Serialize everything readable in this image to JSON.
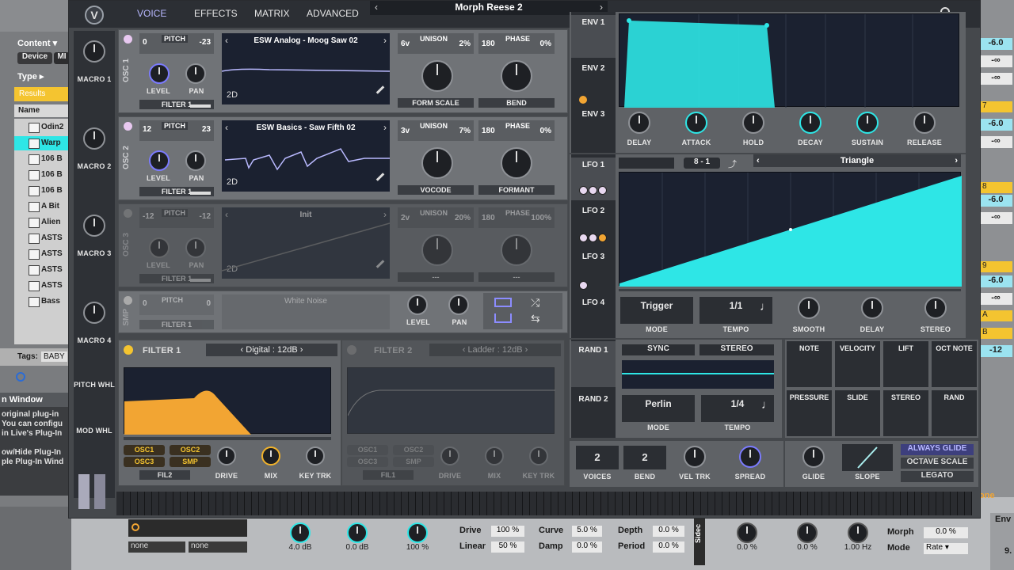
{
  "host": {
    "browser": {
      "content_label": "Content",
      "device_label": "Device",
      "mi_label": "MI",
      "type_label": "Type",
      "results_label": "Results",
      "name_header": "Name",
      "items": [
        "Odin2",
        "Warp",
        "106 B",
        "106 B",
        "106 B",
        "A Bit",
        "Alien",
        "ASTS",
        "ASTS",
        "ASTS",
        "ASTS",
        "Bass"
      ],
      "tags_label": "Tags:",
      "tags_value": "BABY",
      "info_title": "n Window",
      "info_lines": [
        "original plug-in",
        "You can configu",
        "in Live's Plug-In",
        "",
        "ow/Hide Plug-In",
        "ple Plug-In Wind"
      ]
    },
    "bottom": {
      "none_1": "none",
      "none_2": "none",
      "gain_1": "4.0 dB",
      "gain_2": "0.0 dB",
      "gain_3": "100 %",
      "drive_label": "Drive",
      "drive_value": "100 %",
      "linear_label": "Linear",
      "linear_value": "50 %",
      "curve_label": "Curve",
      "curve_value": "5.0 %",
      "damp_label": "Damp",
      "damp_value": "0.0 %",
      "depth_label": "Depth",
      "depth_value": "0.0 %",
      "period_label": "Period",
      "period_value": "0.0 %",
      "sidechain_label": "Sidec",
      "k1_value": "0.0 %",
      "k2_value": "0.0 %",
      "k3_value": "1.00 Hz",
      "morph_label": "Morph",
      "morph_value": "0.0 %",
      "mode_label": "Mode",
      "mode_value": "Rate",
      "env_label": "Env",
      "nine": "9."
    },
    "right_mixer": [
      "-6.0",
      "-∞",
      "-∞",
      "-6.0",
      "-∞",
      "-6.0",
      "-∞",
      "-6.0",
      "-∞",
      "-12"
    ],
    "right_yellow": [
      "7",
      "8",
      "9",
      "A",
      "B"
    ],
    "right_one": "one"
  },
  "plugin": {
    "tabs": [
      "VOICE",
      "EFFECTS",
      "MATRIX",
      "ADVANCED"
    ],
    "preset_name": "Morph Reese 2",
    "macros": [
      "MACRO 1",
      "MACRO 2",
      "MACRO 3",
      "MACRO 4"
    ],
    "pitch_whl": "PITCH WHL",
    "mod_whl": "MOD WHL",
    "osc": [
      {
        "side": "OSC 1",
        "pitch_l": "0",
        "pitch_r": "-23",
        "pitch_label": "PITCH",
        "level": "LEVEL",
        "pan": "PAN",
        "filter": "FILTER 1",
        "wave": "ESW Analog - Moog Saw 02",
        "mode": "2D",
        "unison_l": "6v",
        "unison_label": "UNISON",
        "unison_r": "2%",
        "phase_l": "180",
        "phase_label": "PHASE",
        "phase_r": "0%",
        "knob_a": "FORM SCALE",
        "knob_b": "BEND"
      },
      {
        "side": "OSC 2",
        "pitch_l": "12",
        "pitch_r": "23",
        "pitch_label": "PITCH",
        "level": "LEVEL",
        "pan": "PAN",
        "filter": "FILTER 1",
        "wave": "ESW Basics - Saw Fifth 02",
        "mode": "2D",
        "unison_l": "3v",
        "unison_label": "UNISON",
        "unison_r": "7%",
        "phase_l": "180",
        "phase_label": "PHASE",
        "phase_r": "0%",
        "knob_a": "VOCODE",
        "knob_b": "FORMANT"
      },
      {
        "side": "OSC 3",
        "pitch_l": "-12",
        "pitch_r": "-12",
        "pitch_label": "PITCH",
        "level": "LEVEL",
        "pan": "PAN",
        "filter": "FILTER 1",
        "wave": "Init",
        "mode": "2D",
        "unison_l": "2v",
        "unison_label": "UNISON",
        "unison_r": "20%",
        "phase_l": "180",
        "phase_label": "PHASE",
        "phase_r": "100%",
        "knob_a": "---",
        "knob_b": "---"
      }
    ],
    "smp": {
      "side": "SMP",
      "pitch_l": "0",
      "pitch_r": "0",
      "pitch_label": "PITCH",
      "filter": "FILTER 1",
      "sample": "White Noise",
      "level": "LEVEL",
      "pan": "PAN"
    },
    "filter1": {
      "title": "FILTER 1",
      "type": "Digital : 12dB",
      "osc1": "OSC1",
      "osc2": "OSC2",
      "osc3": "OSC3",
      "smp": "SMP",
      "fil": "FIL2",
      "drive": "DRIVE",
      "mix": "MIX",
      "keytrk": "KEY TRK"
    },
    "filter2": {
      "title": "FILTER 2",
      "type": "Ladder : 12dB",
      "osc1": "OSC1",
      "osc2": "OSC2",
      "osc3": "OSC3",
      "smp": "SMP",
      "fil": "FIL1",
      "drive": "DRIVE",
      "mix": "MIX",
      "keytrk": "KEY TRK"
    },
    "env": {
      "tabs": [
        "ENV 1",
        "ENV 2",
        "ENV 3"
      ],
      "knobs": [
        "DELAY",
        "ATTACK",
        "HOLD",
        "DECAY",
        "SUSTAIN",
        "RELEASE"
      ]
    },
    "lfo": {
      "tabs": [
        "LFO 1",
        "LFO 2",
        "LFO 3",
        "LFO 4"
      ],
      "grid_l": "8",
      "grid_dash": "-",
      "grid_r": "1",
      "shape": "Triangle",
      "mode_value": "Trigger",
      "mode_label": "MODE",
      "tempo_value": "1/1",
      "tempo_label": "TEMPO",
      "smooth": "SMOOTH",
      "delay": "DELAY",
      "stereo": "STEREO"
    },
    "rand": {
      "tabs": [
        "RAND 1",
        "RAND 2"
      ],
      "sync": "SYNC",
      "stereo": "STEREO",
      "mode_value": "Perlin",
      "mode_label": "MODE",
      "tempo_value": "1/4",
      "tempo_label": "TEMPO"
    },
    "mod_sources": [
      "NOTE",
      "VELOCITY",
      "LIFT",
      "OCT NOTE",
      "PRESSURE",
      "SLIDE",
      "STEREO",
      "RAND"
    ],
    "voice": {
      "voices_value": "2",
      "voices_label": "VOICES",
      "bend_value": "2",
      "bend_label": "BEND",
      "veltrk": "VEL TRK",
      "spread": "SPREAD",
      "glide": "GLIDE",
      "slope": "SLOPE",
      "always_glide": "ALWAYS GLIDE",
      "octave_scale": "OCTAVE SCALE",
      "legato": "LEGATO"
    }
  },
  "colors": {
    "cyan": "#2ee6e6",
    "orange": "#f2a533",
    "yellow": "#f4c430",
    "plot_bg": "#1b2130"
  }
}
